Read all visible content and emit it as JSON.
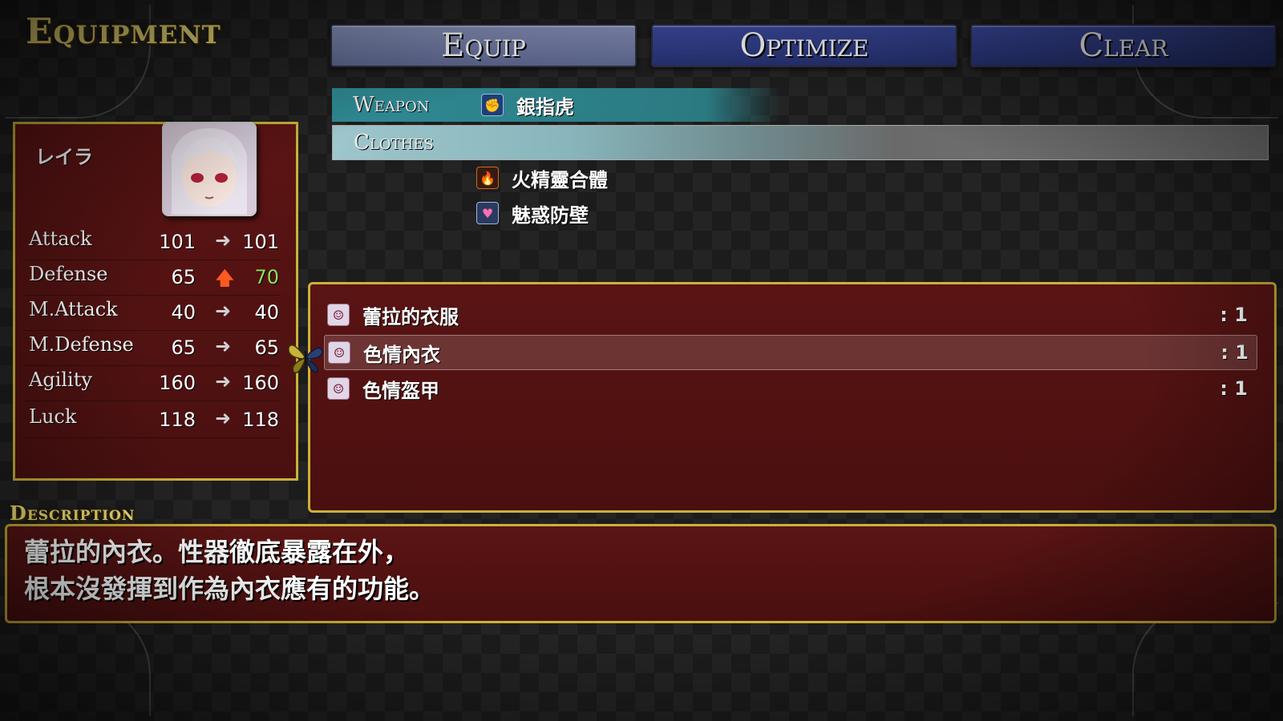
{
  "screen": {
    "title": "Equipment",
    "description_label": "Description"
  },
  "commands": [
    {
      "label": "Equip",
      "state": "active"
    },
    {
      "label": "Optimize",
      "state": "normal"
    },
    {
      "label": "Clear",
      "state": "normal"
    }
  ],
  "slots": {
    "weapon": {
      "label": "Weapon",
      "item": "銀指虎",
      "icon": "fist-icon",
      "state": "equipped"
    },
    "clothes": {
      "label": "Clothes",
      "item": "",
      "state": "selected"
    }
  },
  "accessories": [
    {
      "item": "火精靈合體",
      "icon": "fire-icon"
    },
    {
      "item": "魅惑防壁",
      "icon": "heart-icon"
    }
  ],
  "actor": {
    "name": "レイラ",
    "stats": [
      {
        "name": "Attack",
        "old": "101",
        "new": "101",
        "change": "same"
      },
      {
        "name": "Defense",
        "old": "65",
        "new": "70",
        "change": "up"
      },
      {
        "name": "M.Attack",
        "old": "40",
        "new": "40",
        "change": "same"
      },
      {
        "name": "M.Defense",
        "old": "65",
        "new": "65",
        "change": "same"
      },
      {
        "name": "Agility",
        "old": "160",
        "new": "160",
        "change": "same"
      },
      {
        "name": "Luck",
        "old": "118",
        "new": "118",
        "change": "same"
      }
    ]
  },
  "items": [
    {
      "name": "蕾拉的衣服",
      "count": ": 1",
      "icon": "mask-icon",
      "selected": false
    },
    {
      "name": "色情內衣",
      "count": ": 1",
      "icon": "mask-icon",
      "selected": true
    },
    {
      "name": "色情盔甲",
      "count": ": 1",
      "icon": "mask-icon",
      "selected": false
    }
  ],
  "description": {
    "line1": "蕾拉的內衣。性器徹底暴露在外，",
    "line2": "根本沒發揮到作為內衣應有的功能。"
  },
  "colors": {
    "panel_red": "#4a1010",
    "border_gold": "#c9b23a",
    "stat_up": "#8fe05a",
    "arrow_up": "#ff5a1f"
  }
}
